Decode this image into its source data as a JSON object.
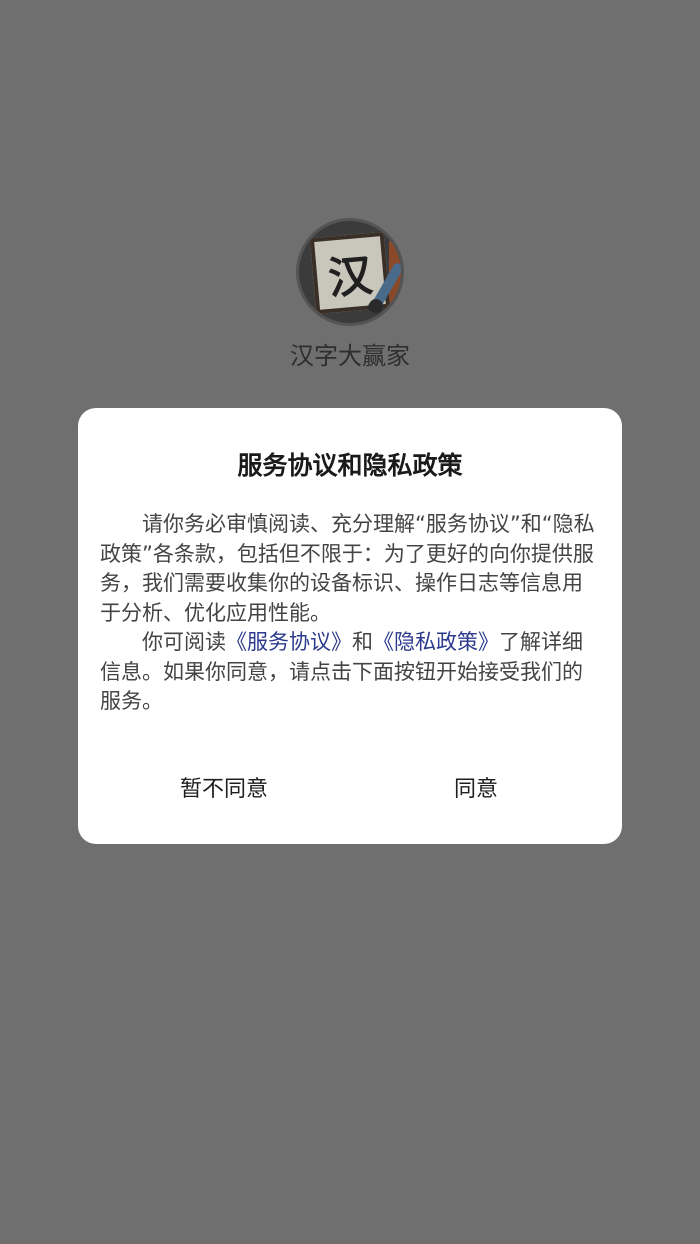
{
  "app": {
    "name": "汉字大赢家",
    "icon_glyph": "汉"
  },
  "dialog": {
    "title": "服务协议和隐私政策",
    "paragraph1": "请你务必审慎阅读、充分理解“服务协议”和“隐私政策”各条款，包括但不限于：为了更好的向你提供服务，我们需要收集你的设备标识、操作日志等信息用于分析、优化应用性能。",
    "paragraph2_prefix": "你可阅读",
    "service_link": "《服务协议》",
    "paragraph2_and": "和",
    "privacy_link": "《隐私政策》",
    "paragraph2_suffix": "了解详细信息。如果你同意，请点击下面按钮开始接受我们的服务。",
    "disagree_label": "暂不同意",
    "agree_label": "同意"
  },
  "colors": {
    "overlay": "#6f6f6f",
    "dialog_bg": "#ffffff",
    "link": "#2c3a8c"
  }
}
